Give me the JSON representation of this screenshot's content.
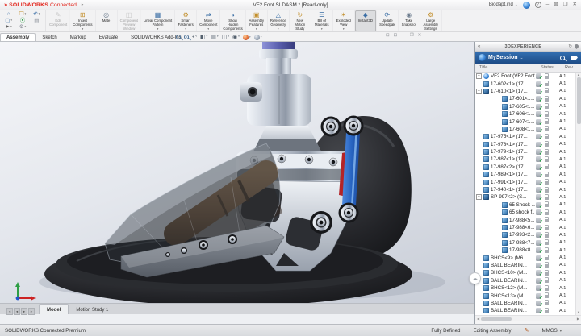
{
  "colors": {
    "logo_red": "#e2231a",
    "panel_blue": "#2a63a4",
    "status_green": "#18a03c",
    "arm_blue": "#2763c0"
  },
  "titlebar": {
    "logo_mark": "»",
    "app_name": "SOLIDWORKS",
    "app_suffix": "Connected",
    "flyout_arrow": "▸",
    "doc_title": "VF2 Foot.SLDASM * [Read-only]",
    "search_value": "Biodapt.ind",
    "search_caret": "⌄",
    "help_glyph": "?",
    "window_controls": [
      {
        "name": "window-minimize",
        "glyph": "–"
      },
      {
        "name": "window-tile",
        "glyph": "⊞"
      },
      {
        "name": "window-restore",
        "glyph": "❐"
      },
      {
        "name": "window-close",
        "glyph": "✕"
      }
    ]
  },
  "qat": [
    {
      "name": "home",
      "glyph": "⌂",
      "color": "#3a6ea5"
    },
    {
      "name": "open",
      "glyph": "❒",
      "color": "#c28e2a",
      "dd": true
    },
    {
      "name": "undo",
      "glyph": "↶",
      "color": "#3a6ea5",
      "dd": true
    },
    {
      "name": "new-document",
      "glyph": "▢",
      "color": "#3a6ea5",
      "dd": true
    },
    {
      "name": "rebuild",
      "glyph": "⦿",
      "color": "#2e9e44"
    },
    {
      "name": "file-properties",
      "glyph": "▤",
      "color": "#8a8f98"
    },
    {
      "name": "select",
      "glyph": "➤",
      "color": "#555555",
      "dd": true
    },
    {
      "name": "options",
      "glyph": "⚙",
      "color": "#8a8f98",
      "dd": true
    }
  ],
  "ribbon": {
    "active_tab": 0,
    "tabs": [
      "Assembly",
      "Sketch",
      "Markup",
      "Evaluate",
      "SOLIDWORKS Add-Ins"
    ],
    "buttons": [
      {
        "name": "edit-component",
        "lines": [
          "Edit",
          "Component"
        ],
        "glyph": "✎",
        "color": "#888888",
        "enabled": false
      },
      {
        "name": "insert-components",
        "lines": [
          "Insert",
          "Components"
        ],
        "glyph": "⊞",
        "color": "#c28e2a",
        "enabled": true,
        "dd": true
      },
      {
        "name": "mate",
        "lines": [
          "Mate"
        ],
        "glyph": "◎",
        "color": "#6a7a8c",
        "enabled": true
      },
      {
        "name": "component-preview-window",
        "lines": [
          "Component",
          "Preview",
          "Window"
        ],
        "glyph": "◫",
        "color": "#888888",
        "enabled": false
      },
      {
        "name": "linear-component-pattern",
        "lines": [
          "Linear Component",
          "Pattern"
        ],
        "glyph": "▦",
        "color": "#3a6ea5",
        "enabled": true,
        "dd": true
      },
      {
        "name": "smart-fasteners",
        "lines": [
          "Smart",
          "Fasteners"
        ],
        "glyph": "⚙",
        "color": "#c28e2a",
        "enabled": true,
        "dd": true
      },
      {
        "name": "move-component",
        "lines": [
          "Move",
          "Component"
        ],
        "glyph": "⇄",
        "color": "#3a6ea5",
        "enabled": true,
        "dd": true
      },
      {
        "name": "show-hidden-components",
        "lines": [
          "Show",
          "Hidden",
          "Components"
        ],
        "glyph": "◑",
        "color": "#3a6ea5",
        "enabled": true
      },
      {
        "name": "assembly-features",
        "lines": [
          "Assembly",
          "Features"
        ],
        "glyph": "▣",
        "color": "#c28e2a",
        "enabled": true,
        "dd": true
      },
      {
        "name": "reference-geometry",
        "lines": [
          "Reference",
          "Geometry"
        ],
        "glyph": "△",
        "color": "#3a6ea5",
        "enabled": true,
        "dd": true
      },
      {
        "name": "new-motion-study",
        "lines": [
          "New",
          "Motion",
          "Study"
        ],
        "glyph": "↻",
        "color": "#c28e2a",
        "enabled": true
      },
      {
        "name": "bill-of-materials",
        "lines": [
          "Bill of",
          "Materials"
        ],
        "glyph": "☰",
        "color": "#3a6ea5",
        "enabled": true,
        "dd": true
      },
      {
        "name": "exploded-view",
        "lines": [
          "Exploded",
          "View"
        ],
        "glyph": "✶",
        "color": "#c28e2a",
        "enabled": true,
        "dd": true
      },
      {
        "name": "instant3d",
        "lines": [
          "Instant3D"
        ],
        "glyph": "◆",
        "color": "#3a6ea5",
        "enabled": true,
        "active": true
      },
      {
        "name": "update-speedpak",
        "lines": [
          "Update",
          "Speedpak"
        ],
        "glyph": "⟳",
        "color": "#3a6ea5",
        "enabled": true
      },
      {
        "name": "take-snapshot",
        "lines": [
          "Take",
          "Snapshot"
        ],
        "glyph": "◉",
        "color": "#6a7a8c",
        "enabled": true
      },
      {
        "name": "large-assembly-settings",
        "lines": [
          "Large",
          "Assembly",
          "Settings"
        ],
        "glyph": "⚙",
        "color": "#c28e2a",
        "enabled": true,
        "dd": true
      }
    ]
  },
  "docwin_controls": [
    {
      "name": "doc-window-new",
      "glyph": "⊡"
    },
    {
      "name": "doc-window-tile",
      "glyph": "⊟"
    },
    {
      "name": "doc-window-minimize",
      "glyph": "—"
    },
    {
      "name": "doc-window-restore",
      "glyph": "❐"
    },
    {
      "name": "doc-window-close",
      "glyph": "✕"
    }
  ],
  "panel": {
    "collapse_glyph": "«",
    "header": "3DEXPERIENCE",
    "refresh_glyph": "↻",
    "session_label": "MySession",
    "session_caret": "⌄",
    "columns": [
      "Title",
      "Status",
      "Rev"
    ],
    "cloud_glyph": "☁",
    "rows": [
      {
        "title": "VF2 Foot (VF2 Foot)",
        "level": 0,
        "expander": true,
        "icon": "root",
        "rev": "A.1"
      },
      {
        "title": "17-602<1> (17...",
        "level": 1,
        "expander": false,
        "icon": "part",
        "rev": "A.1"
      },
      {
        "title": "17-610<1> (17...",
        "level": 1,
        "expander": true,
        "icon": "asm",
        "rev": "A.1"
      },
      {
        "title": "17-601<1...",
        "level": 2,
        "expander": false,
        "icon": "part",
        "rev": "A.1"
      },
      {
        "title": "17-605<1...",
        "level": 2,
        "expander": false,
        "icon": "part",
        "rev": "A.1"
      },
      {
        "title": "17-606<1...",
        "level": 2,
        "expander": false,
        "icon": "part",
        "rev": "A.1"
      },
      {
        "title": "17-607<1...",
        "level": 2,
        "expander": false,
        "icon": "part",
        "rev": "A.1"
      },
      {
        "title": "17-608<1...",
        "level": 2,
        "expander": false,
        "icon": "part",
        "rev": "A.1"
      },
      {
        "title": "17-975<1> (17...",
        "level": 1,
        "expander": false,
        "icon": "part",
        "rev": "A.1"
      },
      {
        "title": "17-978<1> (17...",
        "level": 1,
        "expander": false,
        "icon": "part",
        "rev": "A.1"
      },
      {
        "title": "17-979<1> (17...",
        "level": 1,
        "expander": false,
        "icon": "part",
        "rev": "A.1"
      },
      {
        "title": "17-987<1> (17...",
        "level": 1,
        "expander": false,
        "icon": "part",
        "rev": "A.1"
      },
      {
        "title": "17-987<2> (17...",
        "level": 1,
        "expander": false,
        "icon": "part",
        "rev": "A.1"
      },
      {
        "title": "17-989<1> (17...",
        "level": 1,
        "expander": false,
        "icon": "part",
        "rev": "A.1"
      },
      {
        "title": "17-991<1> (17...",
        "level": 1,
        "expander": false,
        "icon": "part",
        "rev": "A.1"
      },
      {
        "title": "17-940<1> (17...",
        "level": 1,
        "expander": false,
        "icon": "part",
        "rev": "A.1"
      },
      {
        "title": "SP-997<2> (S...",
        "level": 1,
        "expander": true,
        "icon": "asm",
        "rev": "A.1"
      },
      {
        "title": "65 Shock ...",
        "level": 2,
        "expander": false,
        "icon": "part",
        "rev": "A.1"
      },
      {
        "title": "65 shock f...",
        "level": 2,
        "expander": false,
        "icon": "part",
        "rev": "A.1"
      },
      {
        "title": "17-988<5...",
        "level": 2,
        "expander": false,
        "icon": "part",
        "rev": "A.1"
      },
      {
        "title": "17-988<6...",
        "level": 2,
        "expander": false,
        "icon": "part",
        "rev": "A.1"
      },
      {
        "title": "17-993<2...",
        "level": 2,
        "expander": false,
        "icon": "part",
        "rev": "A.1"
      },
      {
        "title": "17-988<7...",
        "level": 2,
        "expander": false,
        "icon": "part",
        "rev": "A.1"
      },
      {
        "title": "17-988<8...",
        "level": 2,
        "expander": false,
        "icon": "part",
        "rev": "A.1"
      },
      {
        "title": "BHCS<9> (M6...",
        "level": 1,
        "expander": false,
        "icon": "part",
        "rev": "A.1"
      },
      {
        "title": "BALL BEARIN...",
        "level": 1,
        "expander": false,
        "icon": "part",
        "rev": "A.1"
      },
      {
        "title": "BHCS<10> (M...",
        "level": 1,
        "expander": false,
        "icon": "part",
        "rev": "A.1"
      },
      {
        "title": "BALL BEARIN...",
        "level": 1,
        "expander": false,
        "icon": "part",
        "rev": "A.1"
      },
      {
        "title": "BHCS<12> (M...",
        "level": 1,
        "expander": false,
        "icon": "part",
        "rev": "A.1"
      },
      {
        "title": "BHCS<13> (M...",
        "level": 1,
        "expander": false,
        "icon": "part",
        "rev": "A.1"
      },
      {
        "title": "BALL BEARIN...",
        "level": 1,
        "expander": false,
        "icon": "part",
        "rev": "A.1"
      },
      {
        "title": "BALL BEARIN...",
        "level": 1,
        "expander": false,
        "icon": "part",
        "rev": "A.1"
      }
    ]
  },
  "bottom": {
    "active": 0,
    "tabs": [
      "Model",
      "Motion Study 1"
    ],
    "nav_glyphs": [
      "◂",
      "◂",
      "▸",
      "▸"
    ]
  },
  "statusbar": {
    "left": "SOLIDWORKS Connected Premium",
    "fully_defined": "Fully Defined",
    "editing": "Editing Assembly",
    "units": "MMGS",
    "units_caret": "▾"
  }
}
